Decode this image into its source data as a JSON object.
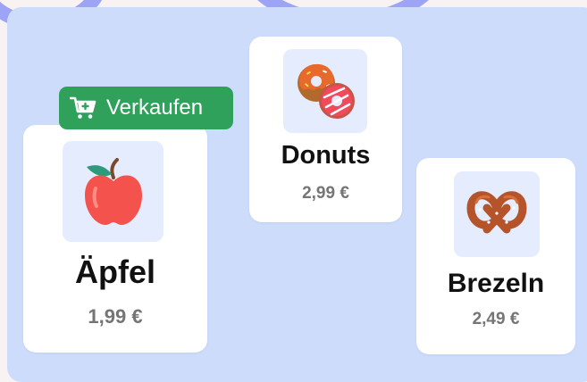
{
  "sell_button": {
    "label": "Verkaufen",
    "icon": "cart-plus-icon",
    "color": "#2fa15b"
  },
  "products": [
    {
      "name": "Äpfel",
      "price": "1,99 €",
      "icon": "apple-icon"
    },
    {
      "name": "Donuts",
      "price": "2,99 €",
      "icon": "donuts-icon"
    },
    {
      "name": "Brezeln",
      "price": "2,49 €",
      "icon": "pretzel-icon"
    }
  ],
  "colors": {
    "panel": "#cddcfb",
    "card": "#ffffff",
    "icon_bg": "#e4ecfd",
    "accent": "#9ea4f5"
  }
}
